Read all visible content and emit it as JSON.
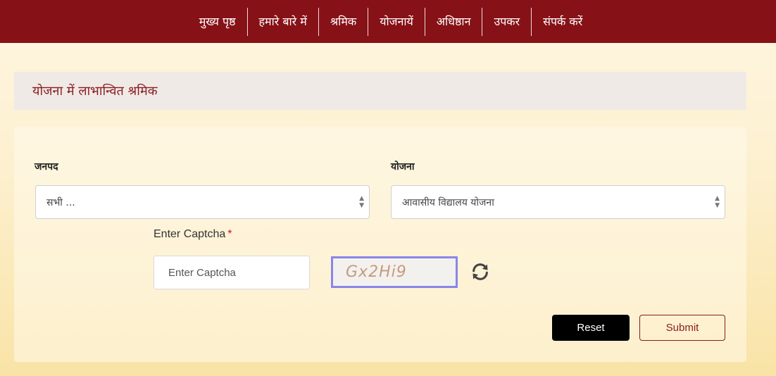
{
  "nav": {
    "items": [
      {
        "label": "मुख्य पृष्ठ"
      },
      {
        "label": "हमारे बारे में"
      },
      {
        "label": "श्रमिक"
      },
      {
        "label": "योजनायें"
      },
      {
        "label": "अधिष्ठान"
      },
      {
        "label": "उपकर"
      },
      {
        "label": "संपर्क करें"
      }
    ]
  },
  "page": {
    "title": "योजना में लाभान्वित श्रमिक"
  },
  "form": {
    "district": {
      "label": "जनपद",
      "selected": "सभी ..."
    },
    "scheme": {
      "label": "योजना",
      "selected": "आवासीय विद्यालय योजना"
    },
    "captcha": {
      "label": "Enter Captcha",
      "required_marker": "*",
      "placeholder": "Enter Captcha",
      "value": "",
      "image_text": "Gx2Hi9"
    },
    "reset_label": "Reset",
    "submit_label": "Submit"
  },
  "colors": {
    "navbar": "#861117",
    "accent": "#8a1a1f",
    "captcha_border": "#8a85e8"
  },
  "icons": {
    "refresh": "refresh-icon",
    "dropdown": "chevron-updown-icon"
  }
}
